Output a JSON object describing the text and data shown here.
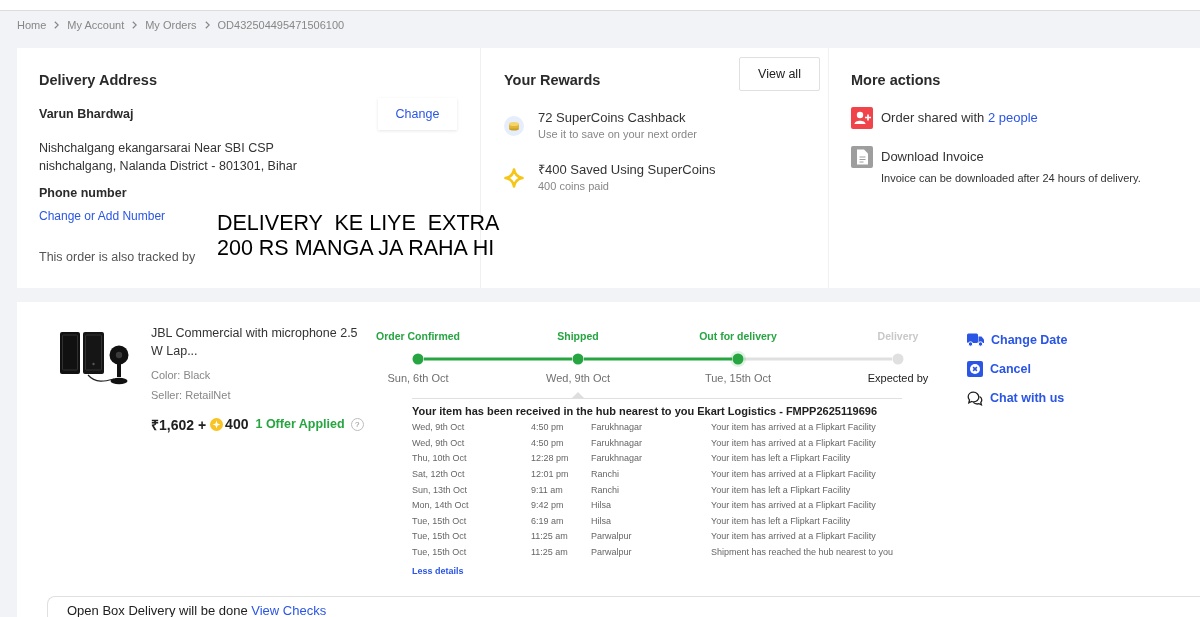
{
  "breadcrumbs": [
    "Home",
    "My Account",
    "My Orders",
    "OD432504495471506100"
  ],
  "delivery_address": {
    "title": "Delivery Address",
    "name": "Varun Bhardwaj",
    "change_button": "Change",
    "address_lines": [
      "Nishchalgang ekangarsarai Near SBI CSP",
      "nishchalgang, Nalanda District - 801301, Bihar"
    ],
    "phone_label": "Phone number",
    "phone_link": "Change or Add Number",
    "tracked_by": "This order is also tracked by"
  },
  "annotation": {
    "lines": [
      "DELIVERY  KE LIYE  EXTRA",
      "200 RS MANGA JA RAHA HI"
    ]
  },
  "rewards": {
    "title": "Your Rewards",
    "view_all": "View all",
    "items": [
      {
        "kind": "coins",
        "title": "72 SuperCoins Cashback",
        "subtitle": "Use it to save on your next order"
      },
      {
        "kind": "saved",
        "title": "₹400 Saved Using SuperCoins",
        "subtitle": "400 coins paid"
      }
    ]
  },
  "more_actions": {
    "title": "More actions",
    "items": [
      {
        "kind": "share",
        "text": "Order shared with",
        "link": "2 people"
      },
      {
        "kind": "invoice",
        "text": "Download Invoice",
        "note": "Invoice can be downloaded after 24 hours of delivery."
      }
    ]
  },
  "order_item": {
    "title": "JBL Commercial with microphone 2.5 W Lap...",
    "variant": "Color: Black",
    "seller": "Seller: RetailNet",
    "price": "₹1,602 +",
    "coins": "400",
    "offer": "1 Offer Applied",
    "help": "?"
  },
  "tracking": {
    "steps": [
      {
        "label": "Order Confirmed",
        "date": "Sun, 6th Oct",
        "done": true,
        "current": false
      },
      {
        "label": "Shipped",
        "date": "Wed, 9th Oct",
        "done": true,
        "current": false,
        "details": {
          "title": "Your item has been received in the hub nearest to you Ekart Logistics - FMPP2625119696",
          "events": [
            {
              "date": "Wed, 9th Oct",
              "time": "4:50 pm",
              "place": "Farukhnagar",
              "message": "Your item has arrived at a Flipkart Facility"
            },
            {
              "date": "Wed, 9th Oct",
              "time": "4:50 pm",
              "place": "Farukhnagar",
              "message": "Your item has arrived at a Flipkart Facility"
            },
            {
              "date": "Thu, 10th Oct",
              "time": "12:28 pm",
              "place": "Farukhnagar",
              "message": "Your item has left a Flipkart Facility"
            },
            {
              "date": "Sat, 12th Oct",
              "time": "12:01 pm",
              "place": "Ranchi",
              "message": "Your item has arrived at a Flipkart Facility"
            },
            {
              "date": "Sun, 13th Oct",
              "time": "9:11 am",
              "place": "Ranchi",
              "message": "Your item has left a Flipkart Facility"
            },
            {
              "date": "Mon, 14th Oct",
              "time": "9:42 pm",
              "place": "Hilsa",
              "message": "Your item has arrived at a Flipkart Facility"
            },
            {
              "date": "Tue, 15th Oct",
              "time": "6:19 am",
              "place": "Hilsa",
              "message": "Your item has left a Flipkart Facility"
            },
            {
              "date": "Tue, 15th Oct",
              "time": "11:25 am",
              "place": "Parwalpur",
              "message": "Your item has arrived at a Flipkart Facility"
            },
            {
              "date": "Tue, 15th Oct",
              "time": "11:25 am",
              "place": "Parwalpur",
              "message": "Shipment has reached the hub nearest to you"
            }
          ],
          "less_details": "Less details"
        }
      },
      {
        "label": "Out for delivery",
        "date": "Tue, 15th Oct",
        "done": true,
        "current": true
      },
      {
        "label": "Delivery",
        "date": "Expected by",
        "done": false,
        "current": false
      }
    ]
  },
  "side_actions": [
    {
      "kind": "change_date",
      "label": "Change Date"
    },
    {
      "kind": "cancel",
      "label": "Cancel"
    },
    {
      "kind": "chat",
      "label": "Chat with us"
    }
  ],
  "open_box": {
    "text": "Open Box Delivery will be done",
    "link": "View Checks"
  }
}
